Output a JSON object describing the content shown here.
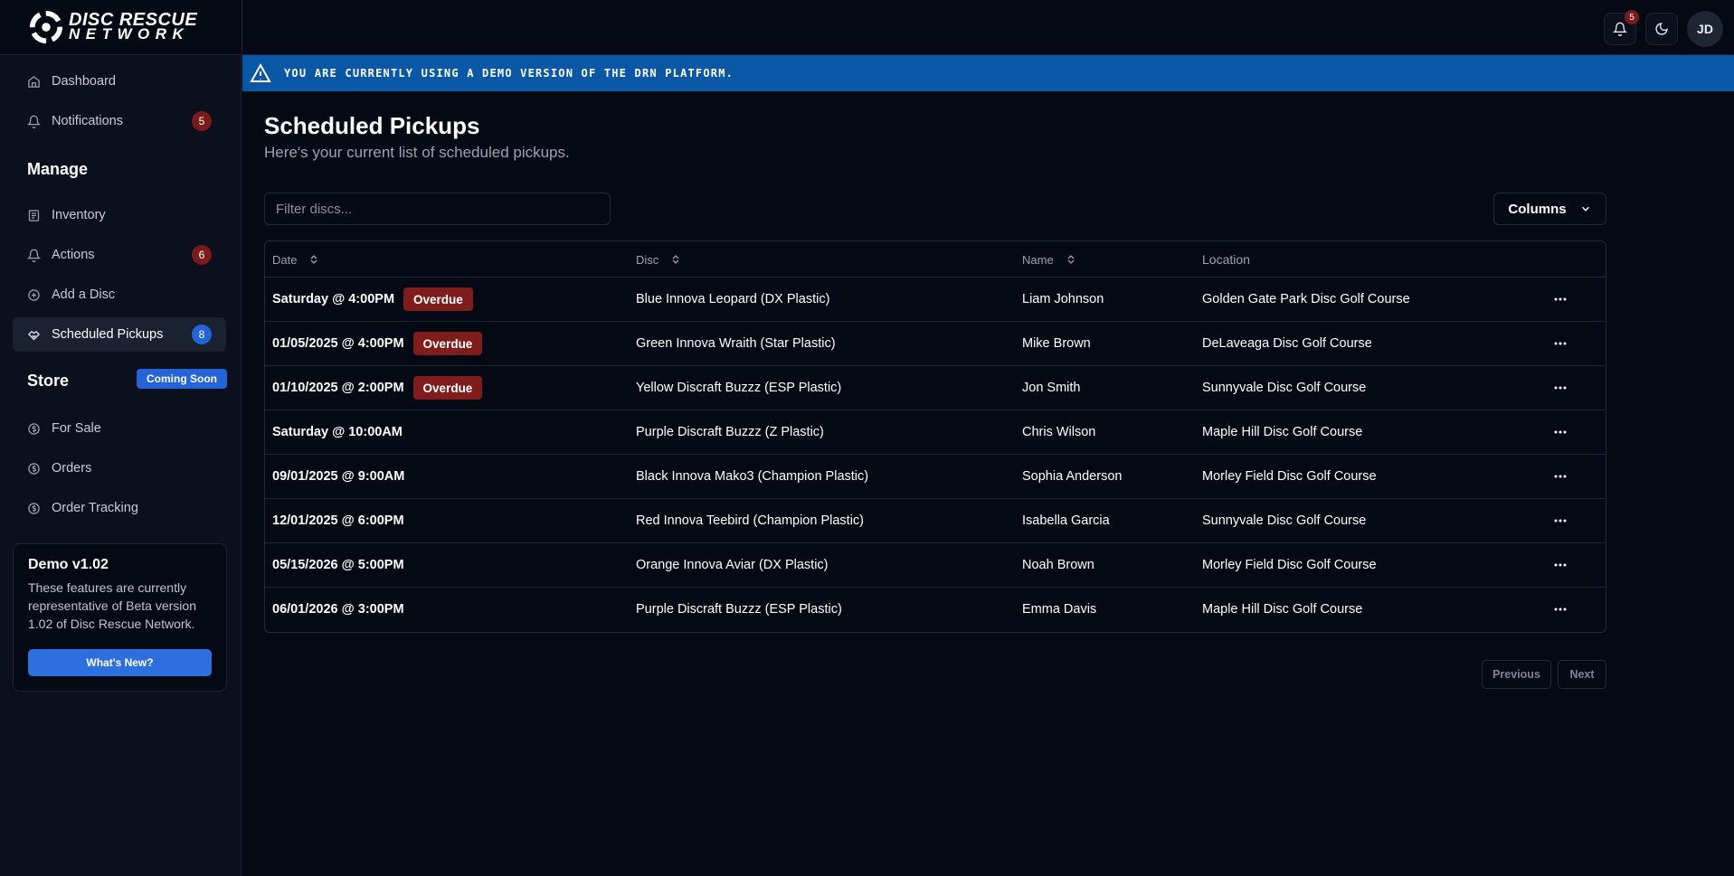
{
  "brand": {
    "line1": "DISC RESCUE",
    "line2": "NETWORK"
  },
  "topbar": {
    "notif_count": "5",
    "avatar_initials": "JD"
  },
  "sidebar": {
    "top_items": [
      {
        "label": "Dashboard",
        "icon": "home-icon"
      },
      {
        "label": "Notifications",
        "icon": "bell-icon",
        "badge": "5"
      }
    ],
    "manage_title": "Manage",
    "manage_items": [
      {
        "label": "Inventory",
        "icon": "inventory-icon"
      },
      {
        "label": "Actions",
        "icon": "bell-icon",
        "badge": "6"
      },
      {
        "label": "Add a Disc",
        "icon": "plus-circle-icon"
      },
      {
        "label": "Scheduled Pickups",
        "icon": "handshake-icon",
        "badge": "8"
      }
    ],
    "store_title": "Store",
    "store_badge": "Coming Soon",
    "store_items": [
      {
        "label": "For Sale",
        "icon": "dollar-icon"
      },
      {
        "label": "Orders",
        "icon": "dollar-icon"
      },
      {
        "label": "Order Tracking",
        "icon": "dollar-icon"
      }
    ],
    "demo_card": {
      "title": "Demo v1.02",
      "body": "These features are currently representative of Beta version 1.02 of Disc Rescue Network.",
      "button": "What's New?"
    }
  },
  "banner": {
    "text": "YOU ARE CURRENTLY USING A DEMO VERSION OF THE DRN PLATFORM."
  },
  "main": {
    "title": "Scheduled Pickups",
    "subtitle": "Here's your current list of scheduled pickups.",
    "filter_placeholder": "Filter discs...",
    "columns_label": "Columns"
  },
  "table": {
    "headers": {
      "date": "Date",
      "disc": "Disc",
      "name": "Name",
      "location": "Location"
    },
    "overdue_label": "Overdue",
    "rows": [
      {
        "date": "Saturday @ 4:00PM",
        "overdue": true,
        "disc": "Blue Innova Leopard (DX Plastic)",
        "name": "Liam Johnson",
        "location": "Golden Gate Park Disc Golf Course"
      },
      {
        "date": "01/05/2025 @ 4:00PM",
        "overdue": true,
        "disc": "Green Innova Wraith (Star Plastic)",
        "name": "Mike Brown",
        "location": "DeLaveaga Disc Golf Course"
      },
      {
        "date": "01/10/2025 @ 2:00PM",
        "overdue": true,
        "disc": "Yellow Discraft Buzzz (ESP Plastic)",
        "name": "Jon Smith",
        "location": "Sunnyvale Disc Golf Course"
      },
      {
        "date": "Saturday @ 10:00AM",
        "overdue": false,
        "disc": "Purple Discraft Buzzz (Z Plastic)",
        "name": "Chris Wilson",
        "location": "Maple Hill Disc Golf Course"
      },
      {
        "date": "09/01/2025 @ 9:00AM",
        "overdue": false,
        "disc": "Black Innova Mako3 (Champion Plastic)",
        "name": "Sophia Anderson",
        "location": "Morley Field Disc Golf Course"
      },
      {
        "date": "12/01/2025 @ 6:00PM",
        "overdue": false,
        "disc": "Red Innova Teebird (Champion Plastic)",
        "name": "Isabella Garcia",
        "location": "Sunnyvale Disc Golf Course"
      },
      {
        "date": "05/15/2026 @ 5:00PM",
        "overdue": false,
        "disc": "Orange Innova Aviar (DX Plastic)",
        "name": "Noah Brown",
        "location": "Morley Field Disc Golf Course"
      },
      {
        "date": "06/01/2026 @ 3:00PM",
        "overdue": false,
        "disc": "Purple Discraft Buzzz (ESP Plastic)",
        "name": "Emma Davis",
        "location": "Maple Hill Disc Golf Course"
      }
    ]
  },
  "pagination": {
    "previous": "Previous",
    "next": "Next"
  },
  "colors": {
    "banner": "#0a58a5",
    "accent": "#2563d8",
    "overdue": "#7f1d1d",
    "background": "#050914"
  }
}
